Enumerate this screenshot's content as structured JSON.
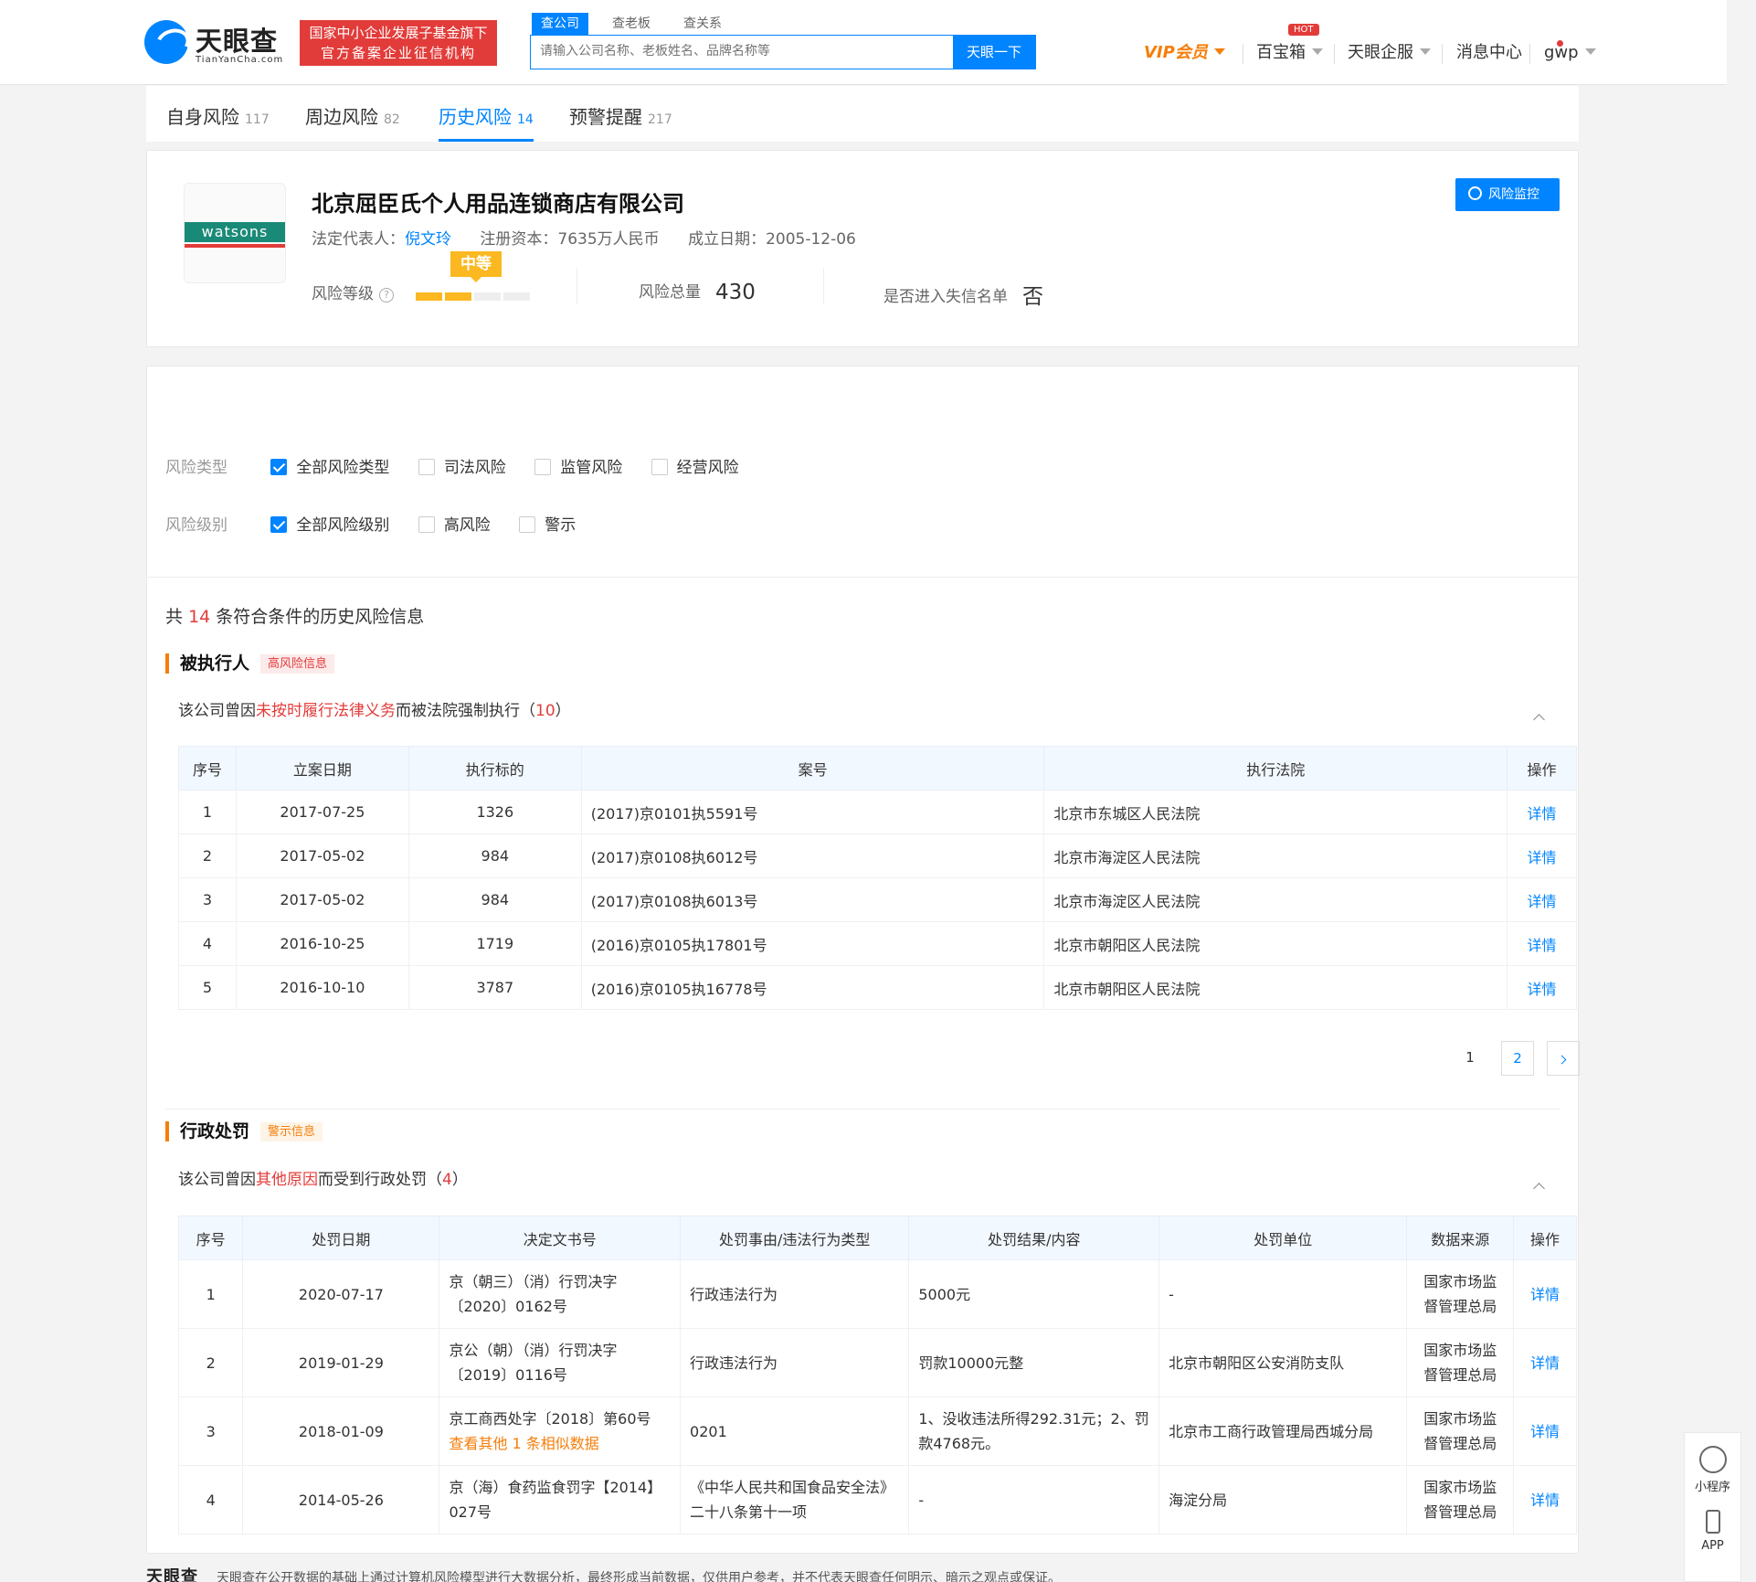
{
  "header": {
    "logo_cn": "天眼查",
    "logo_en": "TianYanCha.com",
    "badge_line1": "国家中小企业发展子基金旗下",
    "badge_line2": "官方备案企业征信机构",
    "search_tabs": [
      "查公司",
      "查老板",
      "查关系"
    ],
    "search_placeholder": "请输入公司名称、老板姓名、品牌名称等",
    "search_button": "天眼一下",
    "vip": "VIP会员",
    "baibaoxiang": "百宝箱",
    "hot": "HOT",
    "qifu": "天眼企服",
    "messages": "消息中心",
    "user": "gwp"
  },
  "tabs": [
    {
      "label": "自身风险",
      "count": "117"
    },
    {
      "label": "周边风险",
      "count": "82"
    },
    {
      "label": "历史风险",
      "count": "14"
    },
    {
      "label": "预警提醒",
      "count": "217"
    }
  ],
  "company": {
    "logo_text": "watsons",
    "name": "北京屈臣氏个人用品连锁商店有限公司",
    "legal_label": "法定代表人：",
    "legal_rep": "倪文玲",
    "capital": "注册资本：7635万人民币",
    "founded": "成立日期：2005-12-06",
    "monitor_button": "风险监控",
    "level_label": "风险等级",
    "level_qm": "?",
    "level_badge": "中等",
    "level_filled_segments": 2,
    "level_total_segments": 4,
    "total_label": "风险总量",
    "total_value": "430",
    "blacklist_label": "是否进入失信名单",
    "blacklist_value": "否"
  },
  "filters": {
    "type_label": "风险类型",
    "type_options": [
      {
        "label": "全部风险类型",
        "checked": true
      },
      {
        "label": "司法风险",
        "checked": false
      },
      {
        "label": "监管风险",
        "checked": false
      },
      {
        "label": "经营风险",
        "checked": false
      }
    ],
    "level_label": "风险级别",
    "level_options": [
      {
        "label": "全部风险级别",
        "checked": true
      },
      {
        "label": "高风险",
        "checked": false
      },
      {
        "label": "警示",
        "checked": false
      }
    ]
  },
  "summary": {
    "prefix": "共",
    "count": "14",
    "suffix": "条符合条件的历史风险信息"
  },
  "section1": {
    "title": "被执行人",
    "tag": "高风险信息",
    "desc_prefix": "该公司曾因",
    "desc_reason": "未按时履行法律义务",
    "desc_suffix": "而被法院强制执行（",
    "desc_count": "10",
    "desc_end": "）",
    "headers": [
      "序号",
      "立案日期",
      "执行标的",
      "案号",
      "执行法院",
      "操作"
    ],
    "rows": [
      [
        "1",
        "2017-07-25",
        "1326",
        "(2017)京0101执5591号",
        "北京市东城区人民法院",
        "详情"
      ],
      [
        "2",
        "2017-05-02",
        "984",
        "(2017)京0108执6012号",
        "北京市海淀区人民法院",
        "详情"
      ],
      [
        "3",
        "2017-05-02",
        "984",
        "(2017)京0108执6013号",
        "北京市海淀区人民法院",
        "详情"
      ],
      [
        "4",
        "2016-10-25",
        "1719",
        "(2016)京0105执17801号",
        "北京市朝阳区人民法院",
        "详情"
      ],
      [
        "5",
        "2016-10-10",
        "3787",
        "(2016)京0105执16778号",
        "北京市朝阳区人民法院",
        "详情"
      ]
    ],
    "pages": [
      "1",
      "2"
    ]
  },
  "section2": {
    "title": "行政处罚",
    "tag": "警示信息",
    "desc_prefix": "该公司曾因",
    "desc_reason": "其他原因",
    "desc_suffix": "而受到行政处罚（",
    "desc_count": "4",
    "desc_end": "）",
    "headers": [
      "序号",
      "处罚日期",
      "决定文书号",
      "处罚事由/违法行为类型",
      "处罚结果/内容",
      "处罚单位",
      "数据来源",
      "操作"
    ],
    "rows": [
      [
        "1",
        "2020-07-17",
        "京（朝三）（消）行罚决字〔2020〕0162号",
        "行政违法行为",
        "5000元",
        "-",
        "国家市场监督管理总局",
        "详情"
      ],
      [
        "2",
        "2019-01-29",
        "京公（朝）（消）行罚决字〔2019〕0116号",
        "行政违法行为",
        "罚款10000元整",
        "北京市朝阳区公安消防支队",
        "国家市场监督管理总局",
        "详情"
      ],
      [
        "3",
        "2018-01-09",
        "京工商西处字〔2018〕第60号",
        "0201",
        "1、没收违法所得292.31元；2、罚款4768元。",
        "北京市工商行政管理局西城分局",
        "国家市场监督管理总局",
        "详情"
      ],
      [
        "4",
        "2014-05-26",
        "京（海）食药监食罚字【2014】027号",
        "《中华人民共和国食品安全法》二十八条第十一项",
        "-",
        "海淀分局",
        "国家市场监督管理总局",
        "详情"
      ]
    ],
    "similar_link": "查看其他 1 条相似数据"
  },
  "sidebar": {
    "mini": "小程序",
    "app": "APP"
  },
  "footer": {
    "logo": "天眼查",
    "text": "天眼查在公开数据的基础上通过计算机风险模型进行大数据分析，最终形成当前数据，仅供用户参考，并不代表天眼查任何明示、暗示之观点或保证。"
  }
}
